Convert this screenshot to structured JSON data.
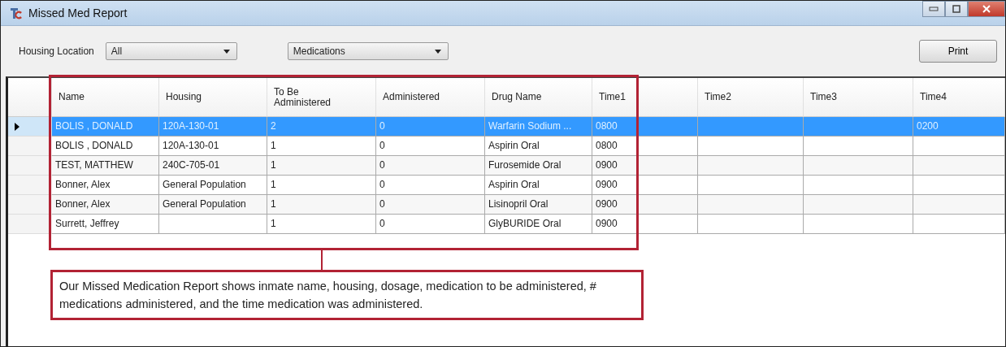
{
  "window": {
    "title": "Missed Med Report"
  },
  "toolbar": {
    "housing_label": "Housing Location",
    "housing_value": "All",
    "category_value": "Medications",
    "print_button": "Print"
  },
  "table": {
    "columns": [
      "Name",
      "Housing",
      "To Be Administered",
      "Administered",
      "Drug Name",
      "Time1",
      "Time2",
      "Time3",
      "Time4"
    ],
    "rows": [
      {
        "selected": true,
        "cells": [
          "BOLIS , DONALD",
          "120A-130-01",
          "2",
          "0",
          "Warfarin Sodium ...",
          "0800",
          null,
          null,
          "0200"
        ]
      },
      {
        "selected": false,
        "cells": [
          "BOLIS , DONALD",
          "120A-130-01",
          "1",
          "0",
          "Aspirin Oral",
          "0800",
          null,
          null,
          null
        ]
      },
      {
        "selected": false,
        "cells": [
          "TEST, MATTHEW",
          "240C-705-01",
          "1",
          "0",
          "Furosemide Oral",
          "0900",
          null,
          null,
          null
        ]
      },
      {
        "selected": false,
        "cells": [
          "Bonner, Alex",
          "General Population",
          "1",
          "0",
          "Aspirin Oral",
          "0900",
          null,
          null,
          null
        ]
      },
      {
        "selected": false,
        "cells": [
          "Bonner, Alex",
          "General Population",
          "1",
          "0",
          "Lisinopril Oral",
          "0900",
          null,
          null,
          null
        ]
      },
      {
        "selected": false,
        "cells": [
          "Surrett, Jeffrey",
          null,
          "1",
          "0",
          "GlyBURIDE Oral",
          "0900",
          null,
          null,
          null
        ]
      }
    ]
  },
  "callout": {
    "text": "Our Missed Medication Report shows inmate name, housing, dosage, medication to be administered, # medications administered, and the time medication was administered."
  }
}
